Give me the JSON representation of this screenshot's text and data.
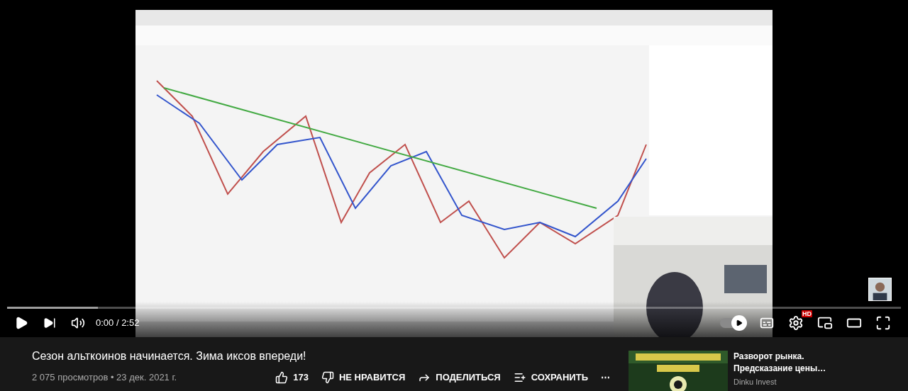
{
  "player": {
    "autoplay": {
      "on": true
    },
    "time": "0:00 / 2:52",
    "hd_badge": "HD"
  },
  "video": {
    "title": "Сезон альткоинов начинается. Зима иксов впереди!",
    "meta": "2 075 просмотров • 23 дек. 2021 г.",
    "actions": [
      {
        "kind": "like",
        "label": "173"
      },
      {
        "kind": "dislike",
        "label": "НЕ НРАВИТСЯ"
      },
      {
        "kind": "share",
        "label": "ПОДЕЛИТЬСЯ"
      },
      {
        "kind": "save",
        "label": "СОХРАНИТЬ"
      },
      {
        "kind": "more",
        "label": "⋯"
      }
    ]
  },
  "recommendation": {
    "title_lines": [
      "Разворот рынка.",
      "Предсказание цены…"
    ],
    "channel": "Dinku Invest"
  }
}
